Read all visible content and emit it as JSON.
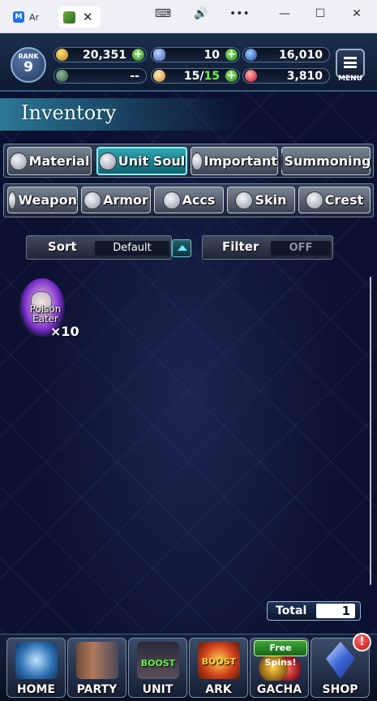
{
  "browser": {
    "tab1_label": "Ar",
    "tab2_close": "✕",
    "controls": [
      "⌨",
      "🔊",
      "•••",
      "—",
      "☐",
      "✕"
    ]
  },
  "status": {
    "rank_label": "RANK",
    "rank_value": "9",
    "gil": "20,351",
    "lapis": "10",
    "blue_orbs": "16,010",
    "energy": "--",
    "stamina_current": "15/",
    "stamina_max": "15",
    "red_orbs": "3,810",
    "menu_label": "MENU"
  },
  "title": "Inventory",
  "categories_row1": [
    "Material",
    "Unit Soul",
    "Important",
    "Summoning"
  ],
  "categories_row2": [
    "Weapon",
    "Armor",
    "Accs",
    "Skin",
    "Crest"
  ],
  "selected_category": "Unit Soul",
  "sort": {
    "label": "Sort",
    "value": "Default"
  },
  "filter": {
    "label": "Filter",
    "value": "OFF"
  },
  "items": [
    {
      "name_line1": "Poison",
      "name_line2": "Eater",
      "count": "×10"
    }
  ],
  "total": {
    "label": "Total",
    "value": "1"
  },
  "nav": {
    "home": "HOME",
    "party": "PARTY",
    "unit": "UNIT",
    "unit_badge": "BOOST",
    "ark": "ARK",
    "ark_badge": "BOOST",
    "gacha": "GACHA",
    "gacha_badge": "Free Spins!",
    "shop": "SHOP",
    "shop_alert": "!"
  },
  "colors": {
    "accent_selected": "#2fa5b1",
    "background": "#0b1130",
    "plus_green": "#2c8a1d",
    "alert_red": "#c40e0e"
  }
}
